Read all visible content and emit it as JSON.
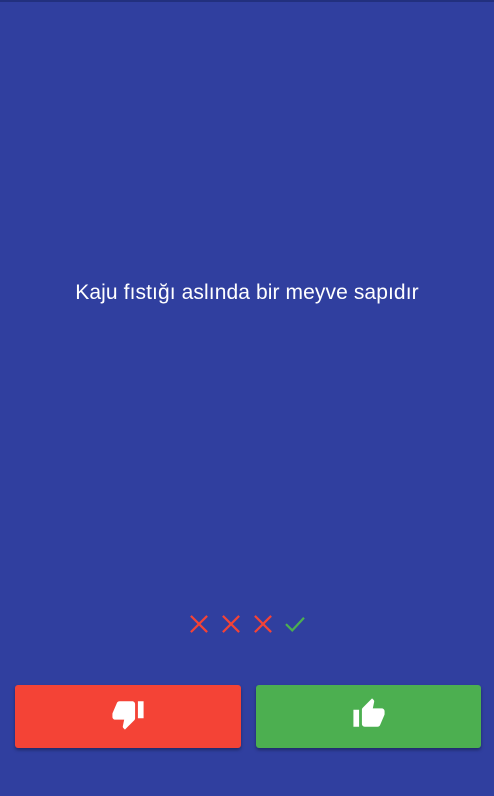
{
  "question": {
    "text": "Kaju fıstığı aslında bir meyve sapıdır"
  },
  "answer_history": [
    {
      "result": "wrong",
      "icon": "close-icon",
      "color": "#f44336"
    },
    {
      "result": "wrong",
      "icon": "close-icon",
      "color": "#f44336"
    },
    {
      "result": "wrong",
      "icon": "close-icon",
      "color": "#f44336"
    },
    {
      "result": "correct",
      "icon": "check-icon",
      "color": "#4caf50"
    }
  ],
  "buttons": {
    "false": {
      "icon": "thumbs-down-icon",
      "color": "#f44336"
    },
    "true": {
      "icon": "thumbs-up-icon",
      "color": "#4caf50"
    }
  },
  "colors": {
    "background": "#303f9f",
    "text": "#ffffff"
  }
}
